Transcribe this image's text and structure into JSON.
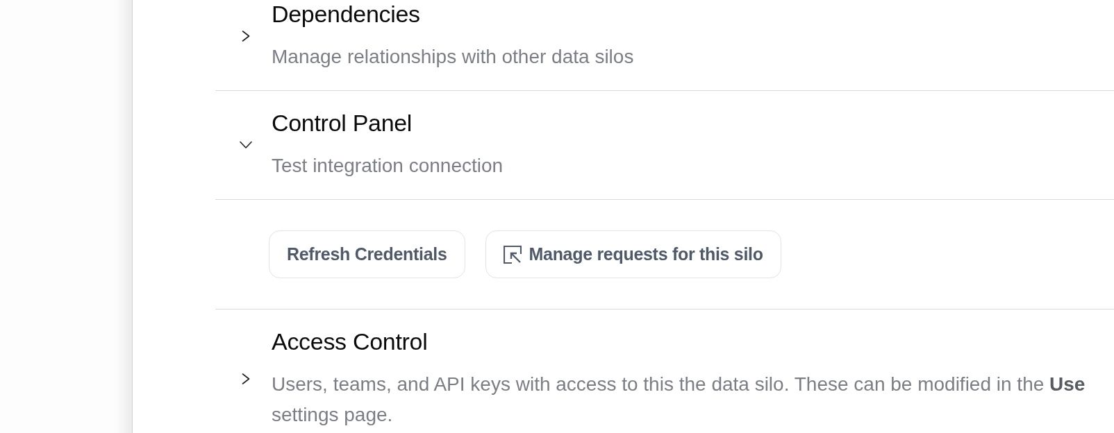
{
  "sections": [
    {
      "title": "Dependencies",
      "description": "Manage relationships with other data silos",
      "expanded": false
    },
    {
      "title": "Control Panel",
      "description": "Test integration connection",
      "expanded": true,
      "actions": [
        {
          "label": "Refresh Credentials",
          "kind": "plain"
        },
        {
          "label": "Manage requests for this silo",
          "kind": "icon"
        }
      ]
    },
    {
      "title": "Access Control",
      "description": "Users, teams, and API keys with access to this the data silo. These can be modified in the **Use** settings page.",
      "expanded": false
    }
  ]
}
